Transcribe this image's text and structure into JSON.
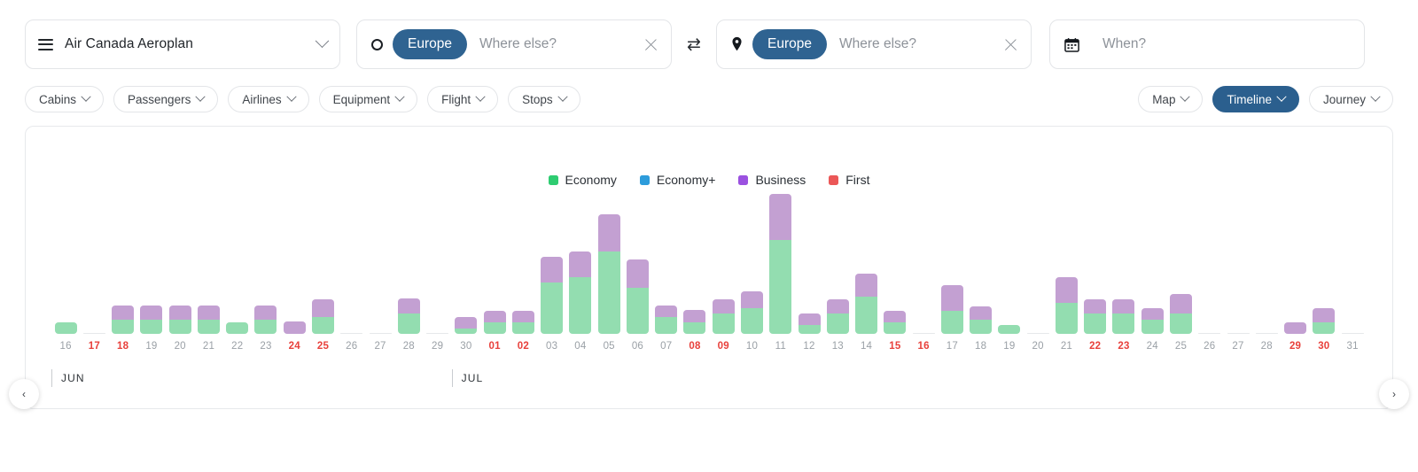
{
  "search": {
    "program": {
      "label": "Air Canada Aeroplan",
      "icon": "hamburger-icon",
      "chevron": "chevron-down-icon"
    },
    "origin": {
      "chip": "Europe",
      "placeholder": "Where else?",
      "icon": "circle-icon",
      "clear": "close-icon"
    },
    "swap": {
      "icon": "swap-icon",
      "glyph": "⇄"
    },
    "destination": {
      "chip": "Europe",
      "placeholder": "Where else?",
      "icon": "location-pin-icon",
      "clear": "close-icon"
    },
    "when": {
      "placeholder": "When?",
      "icon": "calendar-icon"
    }
  },
  "filters": {
    "left": [
      {
        "label": "Cabins",
        "active": false
      },
      {
        "label": "Passengers",
        "active": false
      },
      {
        "label": "Airlines",
        "active": false
      },
      {
        "label": "Equipment",
        "active": false
      },
      {
        "label": "Flight",
        "active": false
      },
      {
        "label": "Stops",
        "active": false
      }
    ],
    "right": [
      {
        "label": "Map",
        "active": false
      },
      {
        "label": "Timeline",
        "active": true
      },
      {
        "label": "Journey",
        "active": false
      }
    ]
  },
  "nav": {
    "prev": "‹",
    "next": "›"
  },
  "colors": {
    "economy": "#2ecc71",
    "economy_plus": "#2d9cdb",
    "business": "#9b51e0",
    "first": "#eb5757",
    "bar_economy": "#93ddb0",
    "bar_business": "#c3a0d2",
    "accent": "#2b5f8e",
    "weekend": "#e8413c",
    "empty": "#e6e8ea"
  },
  "chart_data": {
    "type": "bar",
    "stacked": true,
    "title": "",
    "xlabel": "",
    "ylabel": "",
    "grid": false,
    "legend_position": "top-center",
    "legend": [
      {
        "name": "Economy",
        "color": "#2ecc71"
      },
      {
        "name": "Economy+",
        "color": "#2d9cdb"
      },
      {
        "name": "Business",
        "color": "#9b51e0"
      },
      {
        "name": "First",
        "color": "#eb5757"
      }
    ],
    "months": [
      {
        "label": "JUN",
        "index": 0
      },
      {
        "label": "JUL",
        "index": 14
      }
    ],
    "categories": [
      "16",
      "17",
      "18",
      "19",
      "20",
      "21",
      "22",
      "23",
      "24",
      "25",
      "26",
      "27",
      "28",
      "29",
      "30",
      "01",
      "02",
      "03",
      "04",
      "05",
      "06",
      "07",
      "08",
      "09",
      "10",
      "11",
      "12",
      "13",
      "14",
      "15",
      "16",
      "17",
      "18",
      "19",
      "20",
      "21",
      "22",
      "23",
      "24",
      "25",
      "26",
      "27",
      "28",
      "29",
      "30",
      "31"
    ],
    "weekend_flags": [
      false,
      true,
      true,
      false,
      false,
      false,
      false,
      false,
      true,
      true,
      false,
      false,
      false,
      false,
      false,
      true,
      true,
      false,
      false,
      false,
      false,
      false,
      true,
      true,
      false,
      false,
      false,
      false,
      false,
      true,
      true,
      false,
      false,
      false,
      false,
      false,
      true,
      true,
      false,
      false,
      false,
      false,
      false,
      true,
      true,
      false
    ],
    "series": [
      {
        "name": "Economy",
        "color": "#93ddb0",
        "values": [
          8,
          0,
          10,
          10,
          10,
          10,
          8,
          10,
          0,
          12,
          0,
          0,
          14,
          0,
          4,
          8,
          8,
          36,
          40,
          58,
          32,
          12,
          8,
          14,
          18,
          66,
          6,
          14,
          26,
          8,
          0,
          16,
          10,
          6,
          0,
          22,
          14,
          14,
          10,
          14,
          0,
          0,
          0,
          0,
          8,
          0
        ]
      },
      {
        "name": "Business",
        "color": "#c3a0d2",
        "values": [
          0,
          0,
          10,
          10,
          10,
          10,
          0,
          10,
          9,
          12,
          0,
          0,
          11,
          0,
          8,
          8,
          8,
          18,
          18,
          26,
          20,
          8,
          9,
          10,
          12,
          32,
          8,
          10,
          16,
          8,
          0,
          18,
          9,
          0,
          0,
          18,
          10,
          10,
          8,
          14,
          0,
          0,
          0,
          8,
          10,
          0
        ]
      },
      {
        "name": "Economy+",
        "color": "#2d9cdb",
        "values": [
          0,
          0,
          0,
          0,
          0,
          0,
          0,
          0,
          0,
          0,
          0,
          0,
          0,
          0,
          0,
          0,
          0,
          0,
          0,
          0,
          0,
          0,
          0,
          0,
          0,
          0,
          0,
          0,
          0,
          0,
          0,
          0,
          0,
          0,
          0,
          0,
          0,
          0,
          0,
          0,
          0,
          0,
          0,
          0,
          0,
          0
        ]
      },
      {
        "name": "First",
        "color": "#eb5757",
        "values": [
          0,
          0,
          0,
          0,
          0,
          0,
          0,
          0,
          0,
          0,
          0,
          0,
          0,
          0,
          0,
          0,
          0,
          0,
          0,
          0,
          0,
          0,
          0,
          0,
          0,
          0,
          0,
          0,
          0,
          0,
          0,
          0,
          0,
          0,
          0,
          0,
          0,
          0,
          0,
          0,
          0,
          0,
          0,
          0,
          0,
          0
        ]
      }
    ],
    "ylim": [
      0,
      100
    ]
  }
}
